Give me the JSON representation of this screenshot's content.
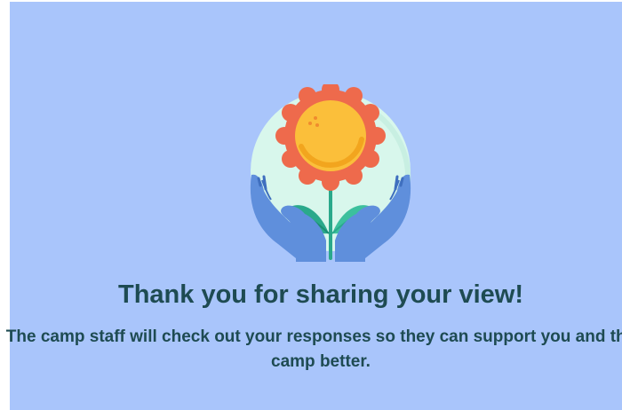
{
  "thank_you": {
    "title": "Thank you for sharing your view!",
    "message": "The camp staff will check out your responses so they can support you and the camp better.",
    "illustration_icon": "hands-holding-flower-icon"
  },
  "colors": {
    "background": "#a9c5fb",
    "text": "#1e4b52",
    "circle": "#d8f7ec",
    "petals": "#ee6a4c",
    "flower_center": "#fbbf3a",
    "leaves": "#2aa98b",
    "hands": "#5f8fdc"
  }
}
